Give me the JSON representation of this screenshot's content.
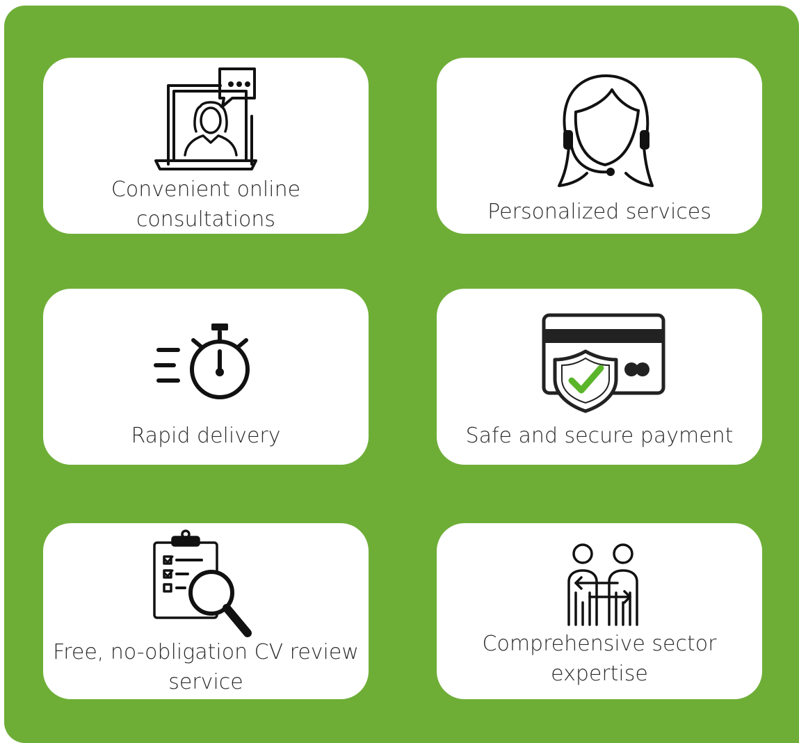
{
  "colors": {
    "background": "#6eae37",
    "card": "#ffffff",
    "text": "#2b2b2b",
    "icon_stroke": "#111111",
    "check": "#5ab52b"
  },
  "features": [
    {
      "icon": "online-consultation-icon",
      "label_lines": [
        "Convenient online",
        "consultations"
      ]
    },
    {
      "icon": "headset-agent-icon",
      "label_lines": [
        "Personalized services"
      ]
    },
    {
      "icon": "stopwatch-speed-icon",
      "label_lines": [
        "Rapid delivery"
      ]
    },
    {
      "icon": "secure-card-shield-icon",
      "label_lines": [
        "Safe and secure payment"
      ]
    },
    {
      "icon": "clipboard-search-icon",
      "label_lines": [
        "Free, no-obligation CV review",
        "service"
      ]
    },
    {
      "icon": "exchange-people-icon",
      "label_lines": [
        "Comprehensive sector",
        "expertise"
      ]
    }
  ]
}
